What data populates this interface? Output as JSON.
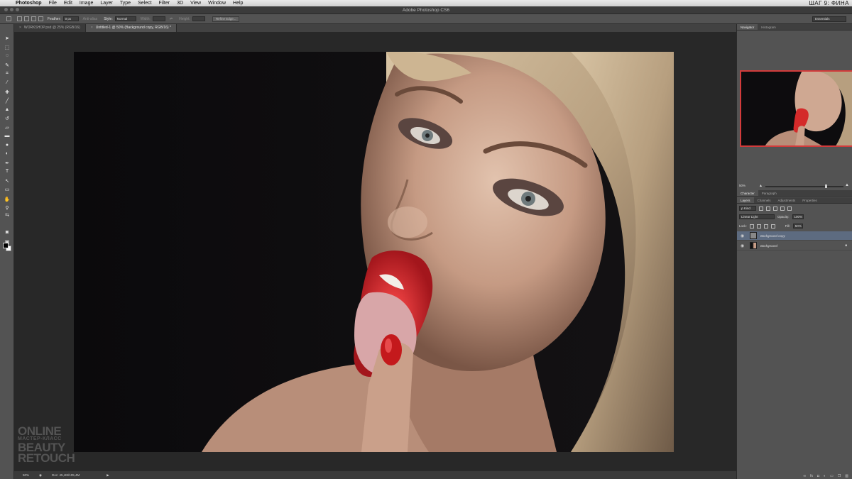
{
  "menubar": {
    "app": "Photoshop",
    "items": [
      "File",
      "Edit",
      "Image",
      "Layer",
      "Type",
      "Select",
      "Filter",
      "3D",
      "View",
      "Window",
      "Help"
    ],
    "right_text": "ШАГ 9: ФИНА"
  },
  "window": {
    "title": "Adobe Photoshop CS6"
  },
  "options_bar": {
    "feather_label": "Feather:",
    "feather_value": "0 px",
    "anti_alias_label": "Anti-alias",
    "style_label": "Style:",
    "style_value": "Normal",
    "width_label": "Width:",
    "height_label": "Height:",
    "refine_edge_label": "Refine Edge...",
    "workspace": "Essentials"
  },
  "tabs": [
    {
      "label": "WORKSHOP.psd @ 25% (RGB/16)",
      "active": false
    },
    {
      "label": "Untitled-1 @ 50% (Background copy, RGB/16) *",
      "active": true
    }
  ],
  "status_bar": {
    "zoom": "50%",
    "doc": "Doc: 45,4M/105,4M"
  },
  "watermark": {
    "line1": "ONLINE",
    "line2": "МАСТЕР-КЛАСС",
    "line3": "BEAUTY",
    "line4": "RETOUCH"
  },
  "navigator": {
    "tabs": [
      "Navigator",
      "Histogram"
    ],
    "zoom": "50%"
  },
  "char_tabs": [
    "Character",
    "Paragraph"
  ],
  "layers_panel": {
    "tabs": [
      "Layers",
      "Channels",
      "Adjustments",
      "Properties"
    ],
    "filter_kind": "Kind",
    "blend_mode": "Linear Light",
    "opacity_label": "Opacity:",
    "opacity_value": "100%",
    "lock_label": "Lock:",
    "fill_label": "Fill:",
    "fill_value": "50%",
    "layers": [
      {
        "name": "Background copy",
        "selected": true
      },
      {
        "name": "Background",
        "selected": false,
        "locked": true
      }
    ]
  }
}
